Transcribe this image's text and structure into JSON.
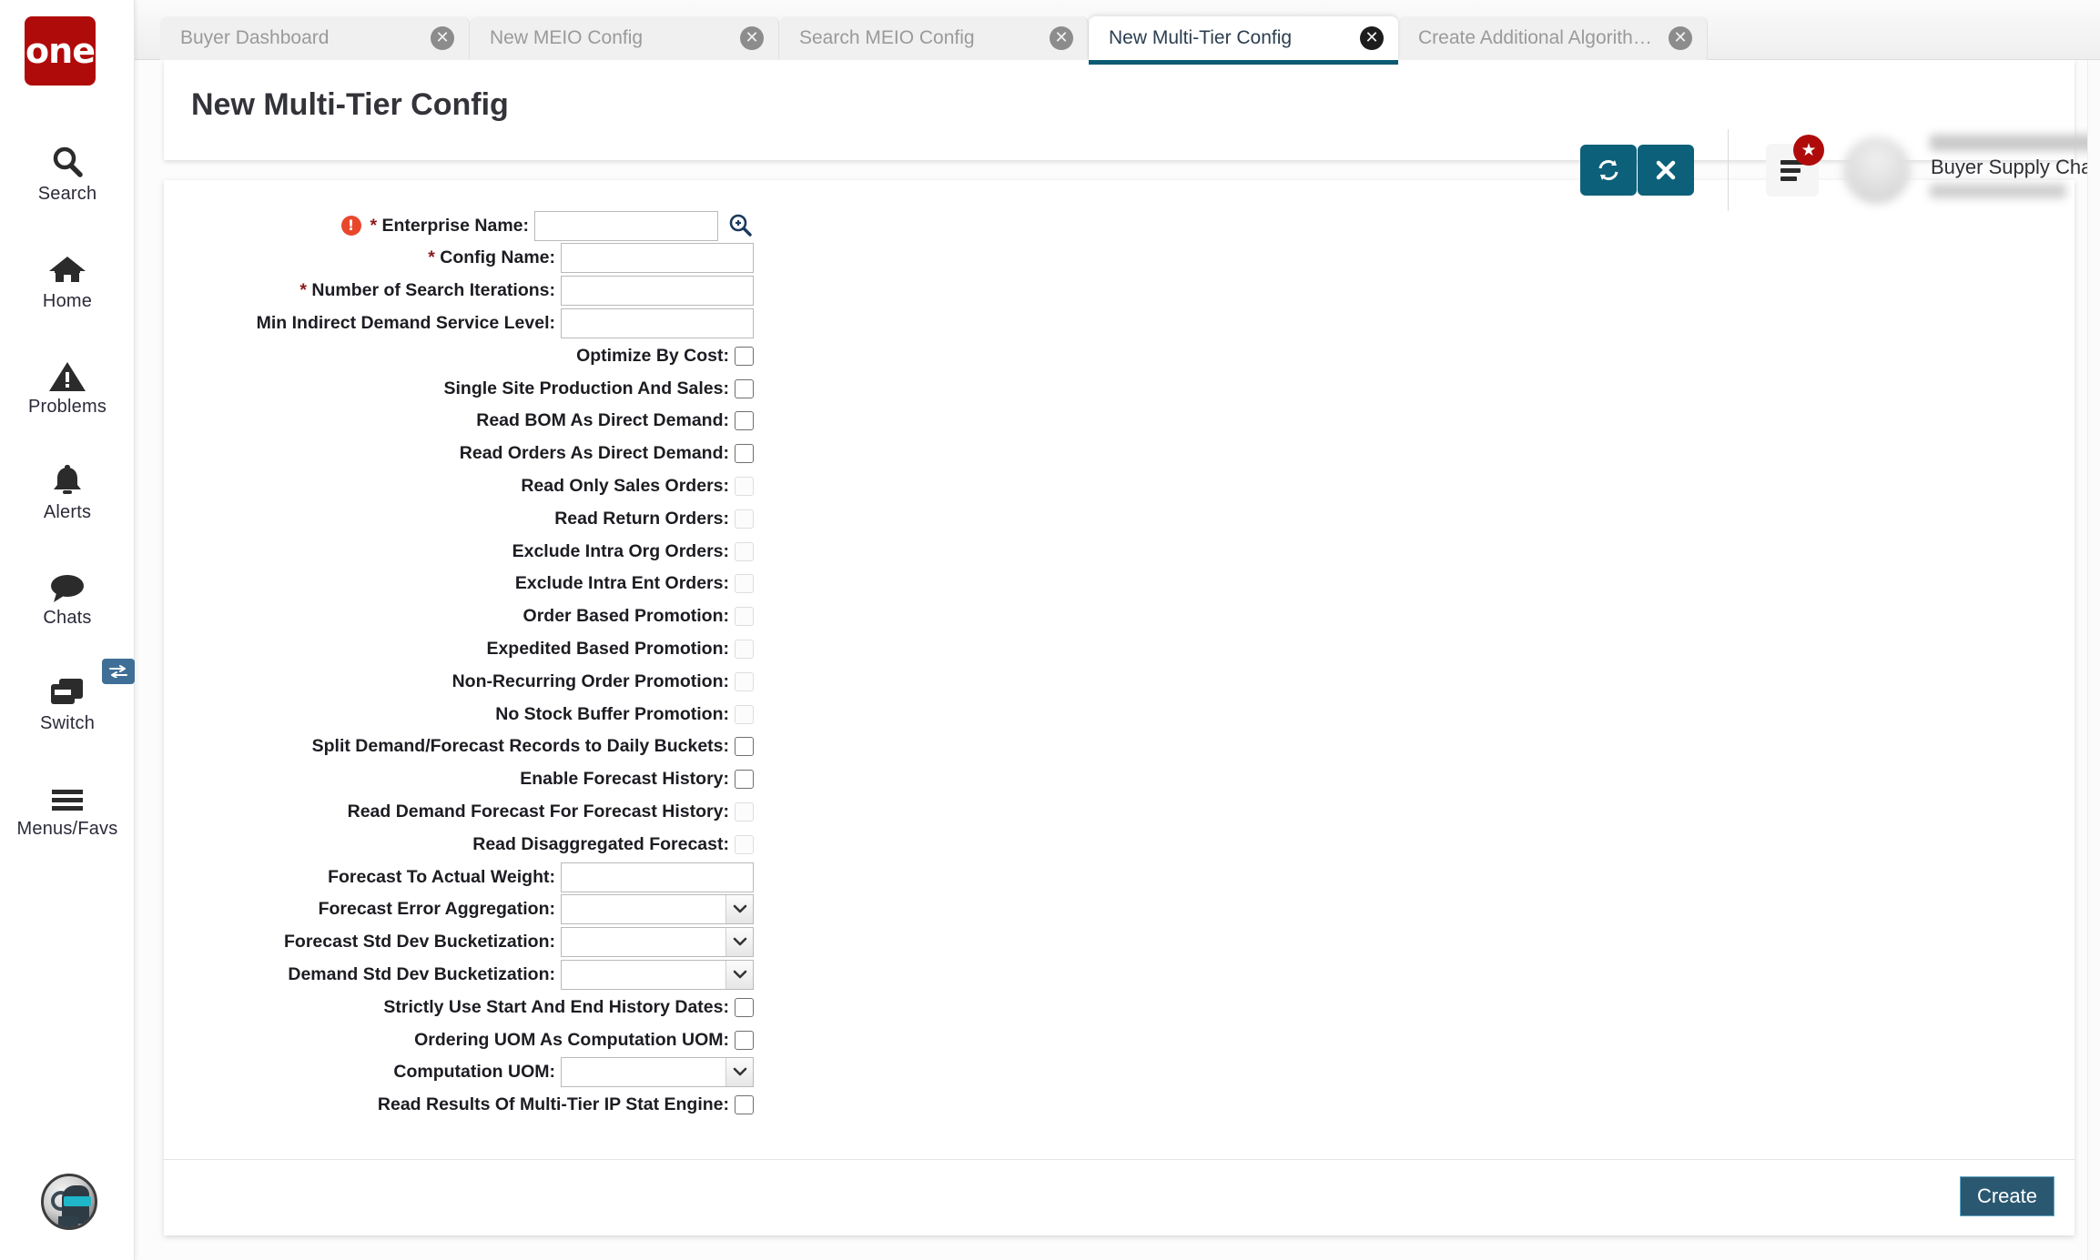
{
  "brand": {
    "logo_text": "one",
    "logo_color": "#b00b0b"
  },
  "rail": {
    "items": [
      {
        "label": "Search",
        "icon": "search-icon"
      },
      {
        "label": "Home",
        "icon": "home-icon"
      },
      {
        "label": "Problems",
        "icon": "warning-triangle-icon"
      },
      {
        "label": "Alerts",
        "icon": "bell-icon"
      },
      {
        "label": "Chats",
        "icon": "chat-bubble-icon"
      },
      {
        "label": "Switch",
        "icon": "switch-cards-icon"
      },
      {
        "label": "Menus/Favs",
        "icon": "hamburger-menu-icon"
      }
    ]
  },
  "tabs": [
    {
      "label": "Buyer Dashboard",
      "active": false
    },
    {
      "label": "New MEIO Config",
      "active": false
    },
    {
      "label": "Search MEIO Config",
      "active": false
    },
    {
      "label": "New Multi-Tier Config",
      "active": true
    },
    {
      "label": "Create Additional Algorithm Con...",
      "active": false
    }
  ],
  "header": {
    "title": "New Multi-Tier Config",
    "refresh_icon": "refresh-icon",
    "close_icon": "close-x-icon",
    "menu_icon": "hamburger-menu-icon",
    "favorites_badge_icon": "star-icon",
    "user_role": "Buyer Supply Chain Admin",
    "caret_icon": "chevron-down-icon",
    "accent_color": "#0d6079",
    "badge_color": "#b00b0b"
  },
  "form": {
    "rows": [
      {
        "label": "Enterprise Name",
        "required": true,
        "error": true,
        "type": "text-lookup",
        "value": "",
        "placeholder": ""
      },
      {
        "label": "Config Name",
        "required": true,
        "error": false,
        "type": "text",
        "value": "",
        "placeholder": ""
      },
      {
        "label": "Number of Search Iterations",
        "required": true,
        "error": false,
        "type": "text",
        "value": "",
        "placeholder": ""
      },
      {
        "label": "Min Indirect Demand Service Level",
        "required": false,
        "error": false,
        "type": "text",
        "value": "",
        "placeholder": ""
      },
      {
        "label": "Optimize By Cost",
        "required": false,
        "error": false,
        "type": "checkbox",
        "checked": false,
        "disabled": false
      },
      {
        "label": "Single Site Production And Sales",
        "required": false,
        "error": false,
        "type": "checkbox",
        "checked": false,
        "disabled": false
      },
      {
        "label": "Read BOM As Direct Demand",
        "required": false,
        "error": false,
        "type": "checkbox",
        "checked": false,
        "disabled": false
      },
      {
        "label": "Read Orders As Direct Demand",
        "required": false,
        "error": false,
        "type": "checkbox",
        "checked": false,
        "disabled": false
      },
      {
        "label": "Read Only Sales Orders",
        "required": false,
        "error": false,
        "type": "checkbox",
        "checked": false,
        "disabled": true
      },
      {
        "label": "Read Return Orders",
        "required": false,
        "error": false,
        "type": "checkbox",
        "checked": false,
        "disabled": true
      },
      {
        "label": "Exclude Intra Org Orders",
        "required": false,
        "error": false,
        "type": "checkbox",
        "checked": false,
        "disabled": true
      },
      {
        "label": "Exclude Intra Ent Orders",
        "required": false,
        "error": false,
        "type": "checkbox",
        "checked": false,
        "disabled": true
      },
      {
        "label": "Order Based Promotion",
        "required": false,
        "error": false,
        "type": "checkbox",
        "checked": false,
        "disabled": true
      },
      {
        "label": "Expedited Based Promotion",
        "required": false,
        "error": false,
        "type": "checkbox",
        "checked": false,
        "disabled": true
      },
      {
        "label": "Non-Recurring Order Promotion",
        "required": false,
        "error": false,
        "type": "checkbox",
        "checked": false,
        "disabled": true
      },
      {
        "label": "No Stock Buffer Promotion",
        "required": false,
        "error": false,
        "type": "checkbox",
        "checked": false,
        "disabled": true
      },
      {
        "label": "Split Demand/Forecast Records to Daily Buckets",
        "required": false,
        "error": false,
        "type": "checkbox",
        "checked": false,
        "disabled": false
      },
      {
        "label": "Enable Forecast History",
        "required": false,
        "error": false,
        "type": "checkbox",
        "checked": false,
        "disabled": false
      },
      {
        "label": "Read Demand Forecast For Forecast History",
        "required": false,
        "error": false,
        "type": "checkbox",
        "checked": false,
        "disabled": true
      },
      {
        "label": "Read Disaggregated Forecast",
        "required": false,
        "error": false,
        "type": "checkbox",
        "checked": false,
        "disabled": true
      },
      {
        "label": "Forecast To Actual Weight",
        "required": false,
        "error": false,
        "type": "text",
        "value": "",
        "placeholder": ""
      },
      {
        "label": "Forecast Error Aggregation",
        "required": false,
        "error": false,
        "type": "select",
        "value": "",
        "options": []
      },
      {
        "label": "Forecast Std Dev Bucketization",
        "required": false,
        "error": false,
        "type": "select",
        "value": "",
        "options": []
      },
      {
        "label": "Demand Std Dev Bucketization",
        "required": false,
        "error": false,
        "type": "select",
        "value": "",
        "options": []
      },
      {
        "label": "Strictly Use Start And End History Dates",
        "required": false,
        "error": false,
        "type": "checkbox",
        "checked": false,
        "disabled": false
      },
      {
        "label": "Ordering UOM As Computation UOM",
        "required": false,
        "error": false,
        "type": "checkbox",
        "checked": false,
        "disabled": false
      },
      {
        "label": "Computation UOM",
        "required": false,
        "error": false,
        "type": "select",
        "value": "",
        "options": []
      },
      {
        "label": "Read Results Of Multi-Tier IP Stat Engine",
        "required": false,
        "error": false,
        "type": "checkbox",
        "checked": false,
        "disabled": false
      }
    ],
    "submit_label": "Create"
  },
  "assistant": {
    "icon": "ai-assistant-avatar-icon"
  }
}
